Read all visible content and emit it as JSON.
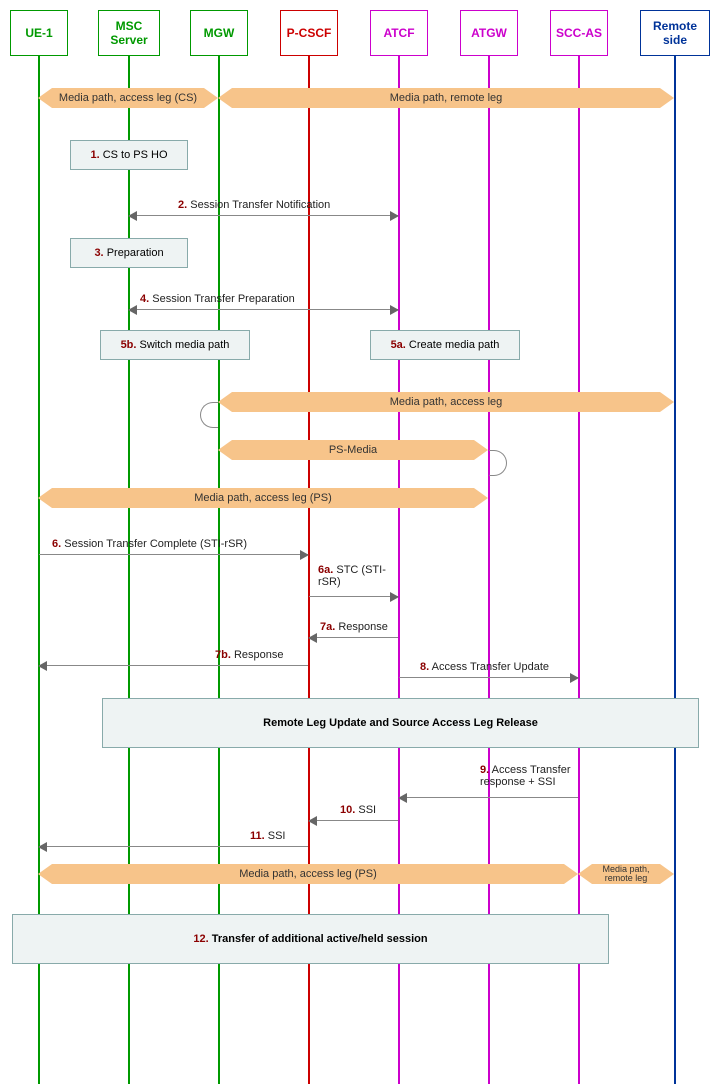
{
  "actors": {
    "ue1": "UE-1",
    "msc": "MSC Server",
    "mgw": "MGW",
    "pcscf": "P-CSCF",
    "atcf": "ATCF",
    "atgw": "ATGW",
    "sccas": "SCC-AS",
    "remote": "Remote side"
  },
  "media": {
    "access_cs": "Media path, access leg (CS)",
    "remote_leg": "Media path, remote leg",
    "access_leg": "Media path, access leg",
    "ps_media": "PS-Media",
    "access_ps": "Media path, access leg (PS)"
  },
  "steps": {
    "s1": {
      "num": "1.",
      "text": "CS to PS HO"
    },
    "s2": {
      "num": "2.",
      "text": "Session Transfer Notification"
    },
    "s3": {
      "num": "3.",
      "text": "Preparation"
    },
    "s4": {
      "num": "4.",
      "text": "Session Transfer Preparation"
    },
    "s5a": {
      "num": "5a.",
      "text": "Create media path"
    },
    "s5b": {
      "num": "5b.",
      "text": "Switch media path"
    },
    "s6": {
      "num": "6.",
      "text": "Session Transfer Complete (STI-rSR)"
    },
    "s6a": {
      "num": "6a.",
      "text": "STC (STI-rSR)"
    },
    "s7a": {
      "num": "7a.",
      "text": "Response"
    },
    "s7b": {
      "num": "7b.",
      "text": "Response"
    },
    "s8": {
      "num": "8.",
      "text": "Access Transfer Update"
    },
    "box_remote": "Remote Leg Update and Source Access Leg Release",
    "s9": {
      "num": "9.",
      "text": "Access Transfer response + SSI"
    },
    "s10": {
      "num": "10.",
      "text": "SSI"
    },
    "s11": {
      "num": "11.",
      "text": "SSI"
    },
    "s12": {
      "num": "12.",
      "text": "Transfer of additional active/held session"
    }
  }
}
